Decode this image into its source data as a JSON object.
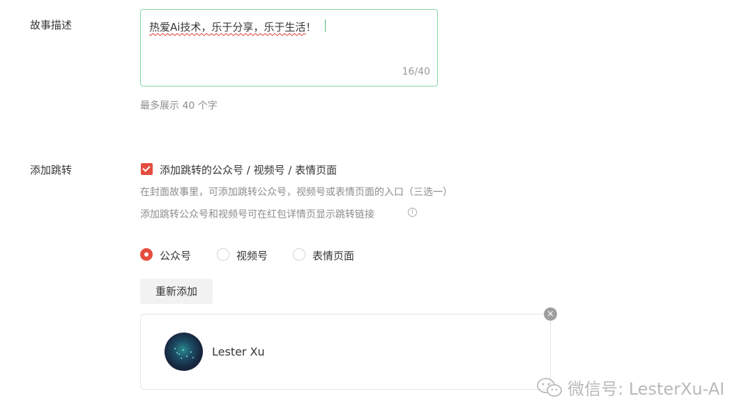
{
  "story": {
    "label": "故事描述",
    "text_underlined": "热爱Ai技术，乐于分享，乐于生活",
    "text_tail": "！",
    "counter": "16/40",
    "hint": "最多展示 40 个字"
  },
  "redirect": {
    "label": "添加跳转",
    "checkbox_label": "添加跳转的公众号 / 视频号 / 表情页面",
    "checked": true,
    "hint_line1": "在封面故事里，可添加跳转公众号，视频号或表情页面的入口（三选一）",
    "hint_line2": "添加跳转公众号和视频号可在红包详情页显示跳转链接",
    "options": [
      {
        "label": "公众号",
        "selected": true
      },
      {
        "label": "视频号",
        "selected": false
      },
      {
        "label": "表情页面",
        "selected": false
      }
    ],
    "re_add_button": "重新添加",
    "account": {
      "name": "Lester Xu"
    },
    "close_icon": "×"
  },
  "watermark": {
    "text": "微信号: LesterXu-AI"
  },
  "colors": {
    "accent": "#e54d3f",
    "focus_border": "#7fd6a0"
  }
}
